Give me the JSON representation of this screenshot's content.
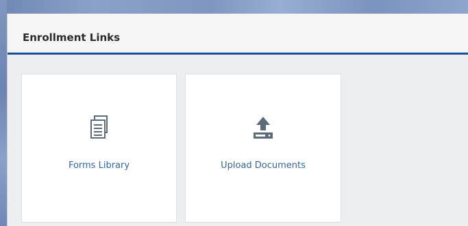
{
  "panel": {
    "title": "Enrollment Links",
    "tiles": [
      {
        "label": "Forms Library",
        "icon": "documents-icon"
      },
      {
        "label": "Upload Documents",
        "icon": "upload-icon"
      }
    ]
  },
  "colors": {
    "accent": "#1a4f98",
    "link": "#2f64a8",
    "icon": "#5b6b7c"
  }
}
